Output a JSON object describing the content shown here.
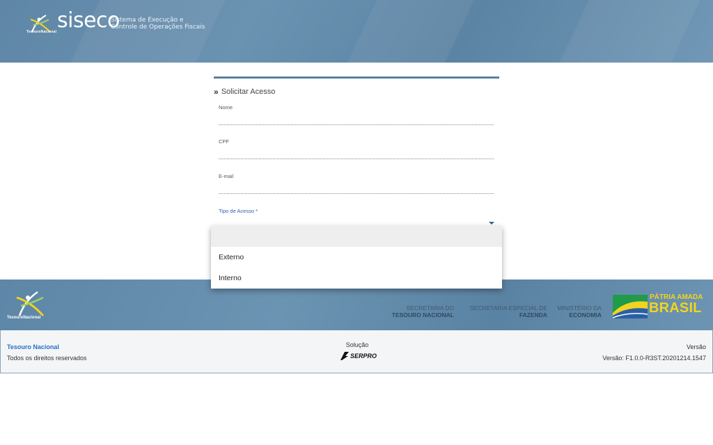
{
  "header": {
    "logo_org": "TesouroNacional",
    "app_name": "siseco",
    "app_subtitle_line1": "Sistema de Execução e",
    "app_subtitle_line2": "Controle de Operações Fiscais"
  },
  "form": {
    "title": "Solicitar Acesso",
    "fields": {
      "nome": {
        "label": "Nome",
        "value": ""
      },
      "cpf": {
        "label": "CPF",
        "value": ""
      },
      "email": {
        "label": "E-mail",
        "value": ""
      },
      "tipo_acesso": {
        "label": "Tipo de Acesso *",
        "value": ""
      }
    }
  },
  "dropdown": {
    "options": [
      "",
      "Externo",
      "Interno"
    ]
  },
  "footer": {
    "tn_logo_text": "TesouroNacional",
    "ministries": [
      {
        "line1": "SECRETARIA DO",
        "line2": "TESOURO NACIONAL"
      },
      {
        "line1": "SECRETARIA ESPECIAL DE",
        "line2": "FAZENDA"
      },
      {
        "line1": "MINISTÉRIO DA",
        "line2": "ECONOMIA"
      }
    ],
    "patria_top": "PÁTRIA AMADA",
    "patria_big": "BRASIL"
  },
  "infobar": {
    "org_name": "Tesouro Nacional",
    "rights": "Todos os direitos reservados",
    "solution_label": "Solução",
    "solution_brand": "SERPRO",
    "version_label": "Versão",
    "version_value": "Versão: F1.0.0-R3ST.20201214.1547"
  },
  "colors": {
    "header_blue": "#6088a8",
    "accent_blue": "#2c5fb3",
    "patria_yellow": "#f2d41f"
  }
}
